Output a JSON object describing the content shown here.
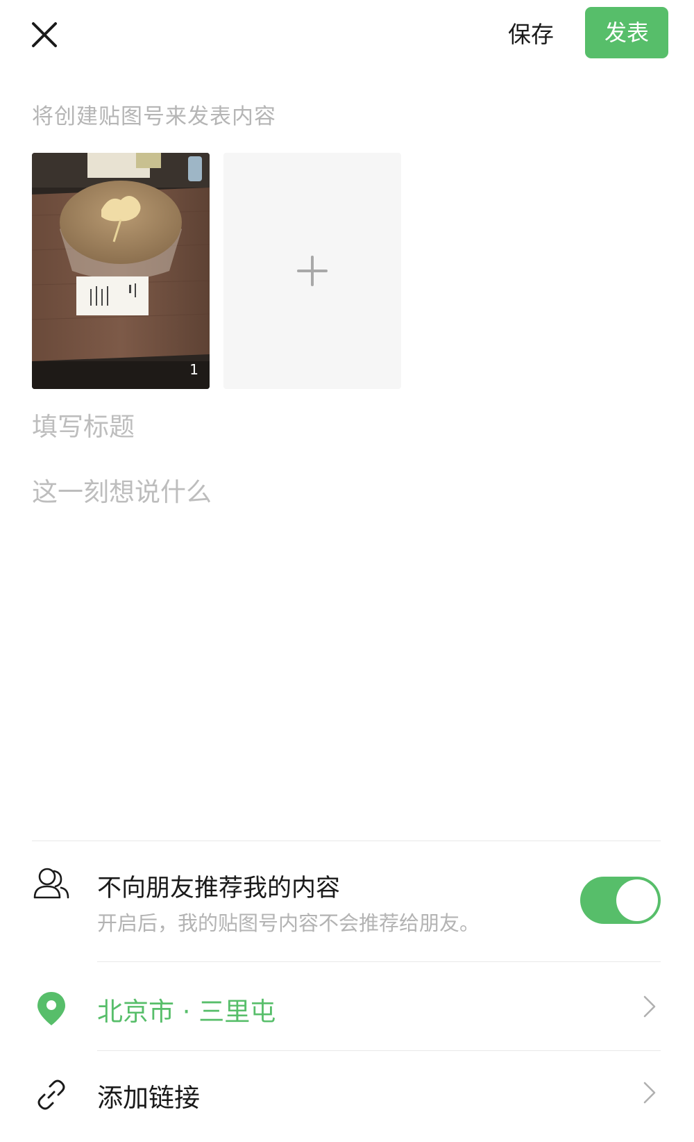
{
  "header": {
    "save_label": "保存",
    "publish_label": "发表"
  },
  "hint_text": "将创建贴图号来发表内容",
  "media": {
    "photo_count": "1"
  },
  "title_field": {
    "placeholder": "填写标题",
    "value": ""
  },
  "body_field": {
    "placeholder": "这一刻想说什么",
    "value": ""
  },
  "recommend": {
    "title": "不向朋友推荐我的内容",
    "subtitle": "开启后，我的贴图号内容不会推荐给朋友。",
    "toggle_on": true
  },
  "location": {
    "label": "北京市 · 三里屯"
  },
  "link": {
    "label": "添加链接"
  },
  "colors": {
    "accent": "#57be6a",
    "placeholder": "#bdbdbd",
    "divider": "#e8e8e8"
  },
  "icons": [
    "close-icon",
    "plus-icon",
    "user-icon",
    "location-pin-icon",
    "link-icon",
    "chevron-right-icon"
  ]
}
